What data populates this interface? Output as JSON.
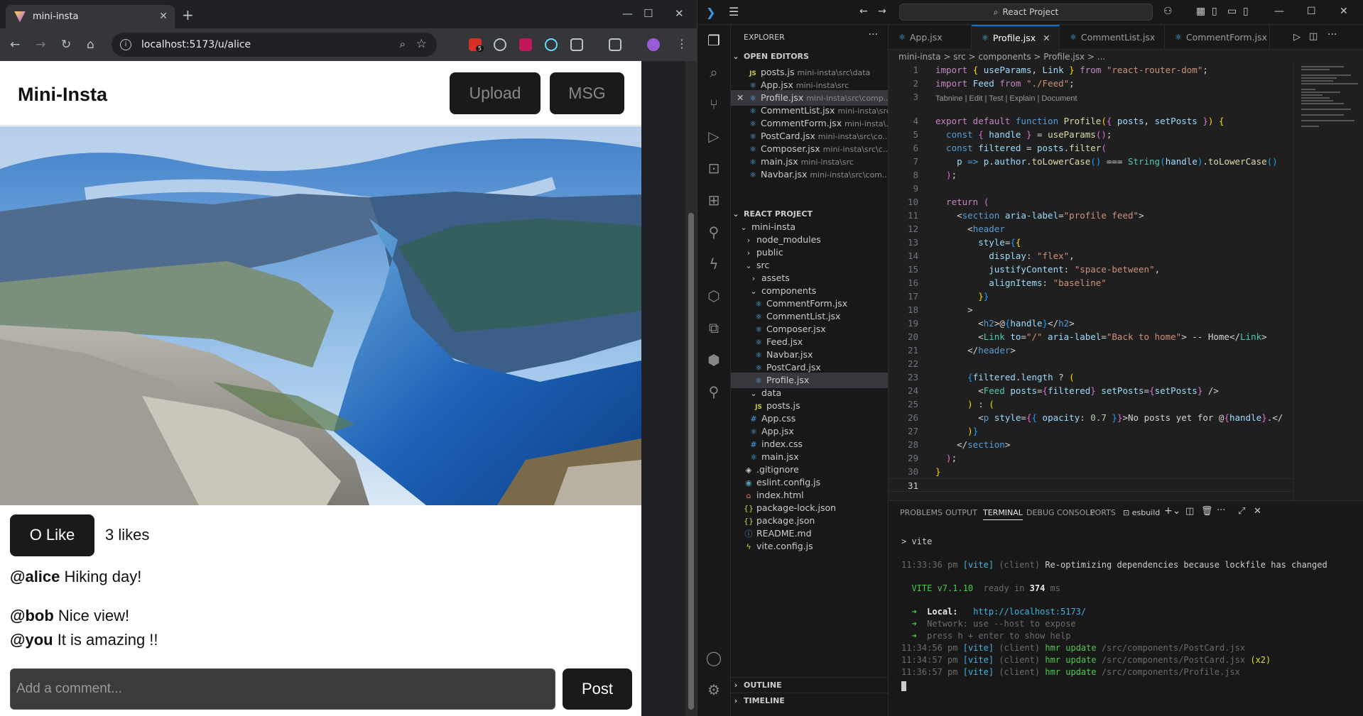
{
  "browser": {
    "tab_title": "mini-insta",
    "url": "localhost:5173/u/alice",
    "ext_badge": "5"
  },
  "app": {
    "brand": "Mini-Insta",
    "upload_label": "Upload",
    "msg_label": "MSG",
    "like_label": "O Like",
    "likes_text": "3 likes",
    "caption_user": "@alice",
    "caption_text": " Hiking day!",
    "comments": [
      {
        "user": "@bob",
        "text": " Nice view!"
      },
      {
        "user": "@you",
        "text": " It is amazing !!"
      }
    ],
    "comment_placeholder": "Add a comment...",
    "post_label": "Post"
  },
  "vscode": {
    "search": "React Project",
    "explorer_title": "EXPLORER",
    "open_editors_title": "OPEN EDITORS",
    "open_editors": [
      {
        "name": "posts.js",
        "path": "mini-insta\\src\\data",
        "icon": "js"
      },
      {
        "name": "App.jsx",
        "path": "mini-insta\\src",
        "icon": "jsx"
      },
      {
        "name": "Profile.jsx",
        "path": "mini-insta\\src\\comp...",
        "icon": "jsx"
      },
      {
        "name": "CommentList.jsx",
        "path": "mini-insta\\src\\...",
        "icon": "jsx"
      },
      {
        "name": "CommentForm.jsx",
        "path": "mini-insta\\...",
        "icon": "jsx"
      },
      {
        "name": "PostCard.jsx",
        "path": "mini-insta\\src\\co...",
        "icon": "jsx"
      },
      {
        "name": "Composer.jsx",
        "path": "mini-insta\\src\\c...",
        "icon": "jsx"
      },
      {
        "name": "main.jsx",
        "path": "mini-insta\\src",
        "icon": "jsx"
      },
      {
        "name": "Navbar.jsx",
        "path": "mini-insta\\src\\com...",
        "icon": "jsx"
      }
    ],
    "project_title": "REACT PROJECT",
    "tree": [
      {
        "name": "mini-insta",
        "indent": 1,
        "icon": "chev-open"
      },
      {
        "name": "node_modules",
        "indent": 2,
        "icon": "chev"
      },
      {
        "name": "public",
        "indent": 2,
        "icon": "chev"
      },
      {
        "name": "src",
        "indent": 2,
        "icon": "chev-open"
      },
      {
        "name": "assets",
        "indent": 3,
        "icon": "chev"
      },
      {
        "name": "components",
        "indent": 3,
        "icon": "chev-open"
      },
      {
        "name": "CommentForm.jsx",
        "indent": 4,
        "icon": "jsx"
      },
      {
        "name": "CommentList.jsx",
        "indent": 4,
        "icon": "jsx"
      },
      {
        "name": "Composer.jsx",
        "indent": 4,
        "icon": "jsx"
      },
      {
        "name": "Feed.jsx",
        "indent": 4,
        "icon": "jsx"
      },
      {
        "name": "Navbar.jsx",
        "indent": 4,
        "icon": "jsx"
      },
      {
        "name": "PostCard.jsx",
        "indent": 4,
        "icon": "jsx"
      },
      {
        "name": "Profile.jsx",
        "indent": 4,
        "icon": "jsx"
      },
      {
        "name": "data",
        "indent": 3,
        "icon": "chev-open"
      },
      {
        "name": "posts.js",
        "indent": 4,
        "icon": "js"
      },
      {
        "name": "App.css",
        "indent": 3,
        "icon": "css"
      },
      {
        "name": "App.jsx",
        "indent": 3,
        "icon": "jsx"
      },
      {
        "name": "index.css",
        "indent": 3,
        "icon": "css"
      },
      {
        "name": "main.jsx",
        "indent": 3,
        "icon": "jsx"
      },
      {
        "name": ".gitignore",
        "indent": 2,
        "icon": "git"
      },
      {
        "name": "eslint.config.js",
        "indent": 2,
        "icon": "eslint"
      },
      {
        "name": "index.html",
        "indent": 2,
        "icon": "html"
      },
      {
        "name": "package-lock.json",
        "indent": 2,
        "icon": "json"
      },
      {
        "name": "package.json",
        "indent": 2,
        "icon": "json"
      },
      {
        "name": "README.md",
        "indent": 2,
        "icon": "md"
      },
      {
        "name": "vite.config.js",
        "indent": 2,
        "icon": "vite"
      }
    ],
    "outline_title": "OUTLINE",
    "timeline_title": "TIMELINE",
    "tabs": [
      "App.jsx",
      "Profile.jsx",
      "CommentList.jsx",
      "CommentForm.jsx"
    ],
    "breadcrumb": "mini-insta > src > components > Profile.jsx > ...",
    "codelens": "Tabnine | Edit | Test | Explain | Document",
    "panel_tabs": [
      "PROBLEMS",
      "OUTPUT",
      "TERMINAL",
      "DEBUG CONSOLE",
      "PORTS"
    ],
    "terminal_name": "esbuild",
    "terminal": {
      "cmd": "> vite",
      "line1_time": "11:33:36 pm",
      "line1_msg": " Re-optimizing dependencies because lockfile has changed",
      "vite_version": "VITE v7.1.10",
      "ready": "ready in ",
      "ready_ms": "374",
      "local_label": "Local:",
      "local_url": "http://localhost:5173/",
      "network": "Network: use --host to expose",
      "help": "press h + enter to show help",
      "hmr": [
        {
          "time": "11:34:56 pm",
          "file": "/src/components/PostCard.jsx",
          "extra": ""
        },
        {
          "time": "11:34:57 pm",
          "file": "/src/components/PostCard.jsx",
          "extra": "(x2)"
        },
        {
          "time": "11:36:57 pm",
          "file": "/src/components/Profile.jsx",
          "extra": ""
        }
      ]
    }
  }
}
